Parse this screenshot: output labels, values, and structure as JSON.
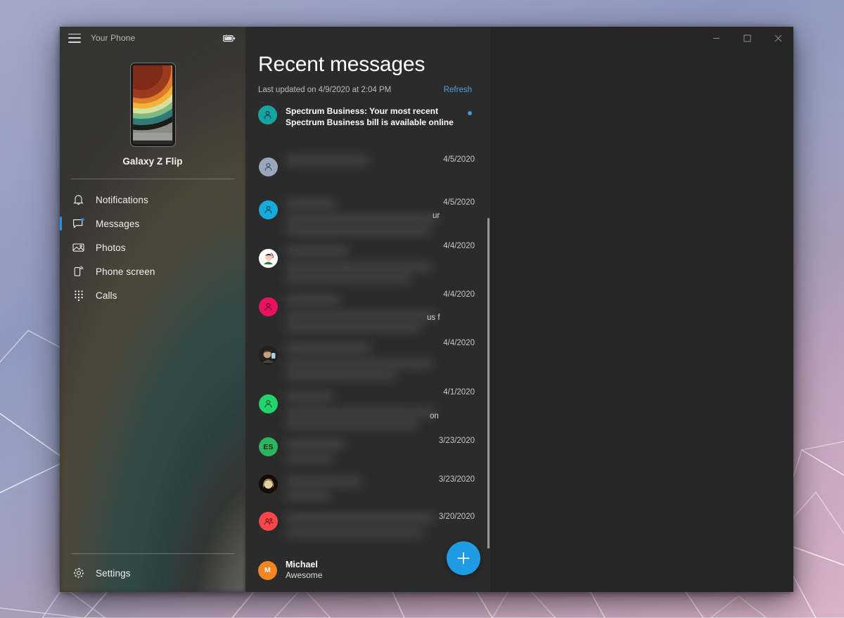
{
  "window": {
    "app_title": "Your Phone",
    "menu_icon": "hamburger-icon",
    "battery_icon": "battery-charging-icon",
    "controls": {
      "minimize_label": "─",
      "maximize_label": "□",
      "close_label": "✕"
    }
  },
  "sidebar": {
    "device_name": "Galaxy Z Flip",
    "items": [
      {
        "label": "Notifications",
        "icon": "bell-icon",
        "active": false,
        "badge": false
      },
      {
        "label": "Messages",
        "icon": "chat-icon",
        "active": true,
        "badge": true
      },
      {
        "label": "Photos",
        "icon": "photo-icon",
        "active": false,
        "badge": false
      },
      {
        "label": "Phone screen",
        "icon": "phone-cast-icon",
        "active": false,
        "badge": false
      },
      {
        "label": "Calls",
        "icon": "dialpad-icon",
        "active": false,
        "badge": false
      }
    ],
    "settings": {
      "label": "Settings",
      "icon": "gear-icon"
    }
  },
  "messages": {
    "title": "Recent messages",
    "last_updated": "Last updated on 4/9/2020 at 2:04 PM",
    "refresh_label": "Refresh",
    "rows": [
      {
        "avatar_color": "#16A3A3",
        "avatar_kind": "person",
        "snippet_line1": "Spectrum Business: Your most recent",
        "snippet_line2": "Spectrum Business bill is available online",
        "unread": true,
        "date": "",
        "redacted": false
      },
      {
        "avatar_color": "#9BA7BC",
        "avatar_kind": "person",
        "date": "4/5/2020",
        "redacted": true,
        "edge_text": ""
      },
      {
        "avatar_color": "#16ABDC",
        "avatar_kind": "person",
        "date": "4/5/2020",
        "redacted": true,
        "edge_text": "ur"
      },
      {
        "avatar_color": "#F4F4F4",
        "avatar_kind": "photo-1",
        "date": "4/4/2020",
        "redacted": true,
        "edge_text": ""
      },
      {
        "avatar_color": "#E8135F",
        "avatar_kind": "person",
        "date": "4/4/2020",
        "redacted": true,
        "edge_text": "us f"
      },
      {
        "avatar_color": "#2A2A2A",
        "avatar_kind": "photo-2",
        "date": "4/4/2020",
        "redacted": true,
        "edge_text": ""
      },
      {
        "avatar_color": "#23D36B",
        "avatar_kind": "person",
        "date": "4/1/2020",
        "redacted": true,
        "edge_text": "on"
      },
      {
        "avatar_color": "#2BB561",
        "avatar_kind": "initials",
        "initials": "ES",
        "date": "3/23/2020",
        "redacted": true,
        "edge_text": ""
      },
      {
        "avatar_color": "#161008",
        "avatar_kind": "photo-3",
        "date": "3/23/2020",
        "redacted": true,
        "edge_text": ""
      },
      {
        "avatar_color": "#F8474C",
        "avatar_kind": "group",
        "date": "3/20/2020",
        "redacted": true,
        "edge_text": ""
      }
    ],
    "pinned": {
      "avatar_color": "#F08622",
      "initials": "M",
      "name": "Michael",
      "preview": "Awesome",
      "partial_date": "0"
    },
    "compose": {
      "icon": "plus-icon",
      "color": "#1F9BE4"
    }
  },
  "colors": {
    "accent": "#2A8FD8",
    "unread_dot": "#3B9AE1",
    "link": "#4AA3E0",
    "window_bg": "#262626",
    "panel_bg": "#2B2B2B"
  }
}
